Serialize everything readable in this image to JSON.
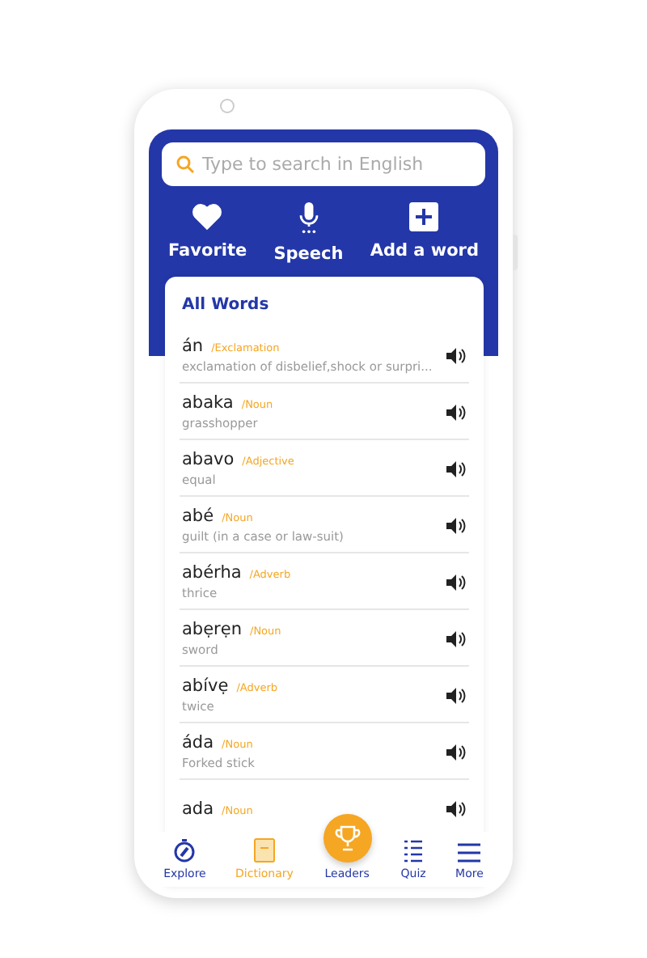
{
  "search": {
    "placeholder": "Type to search in English"
  },
  "actions": [
    {
      "kind": "heart",
      "label": "Favorite"
    },
    {
      "kind": "mic",
      "label": "Speech"
    },
    {
      "kind": "plus",
      "label": "Add a word"
    }
  ],
  "list": {
    "title": "All Words",
    "words": [
      {
        "word": "án",
        "part": "/Exclamation",
        "meaning": "exclamation of disbelief,shock or surpri..."
      },
      {
        "word": "abaka",
        "part": "/Noun",
        "meaning": "grasshopper"
      },
      {
        "word": "abavo",
        "part": "/Adjective",
        "meaning": "equal"
      },
      {
        "word": "abé",
        "part": "/Noun",
        "meaning": "guilt (in a case or law-suit)"
      },
      {
        "word": "abérha",
        "part": "/Adverb",
        "meaning": "thrice"
      },
      {
        "word": "abẹrẹn",
        "part": "/Noun",
        "meaning": "sword"
      },
      {
        "word": "abívẹ",
        "part": "/Adverb",
        "meaning": "twice"
      },
      {
        "word": "áda",
        "part": "/Noun",
        "meaning": "Forked stick"
      },
      {
        "word": "ada",
        "part": "/Noun"
      }
    ]
  },
  "nav": [
    {
      "kind": "compass",
      "label": "Explore",
      "selected": false
    },
    {
      "kind": "book",
      "label": "Dictionary",
      "selected": true
    },
    {
      "kind": "trophy",
      "label": "Leaders",
      "selected": false
    },
    {
      "kind": "quiz",
      "label": "Quiz",
      "selected": false
    },
    {
      "kind": "menu",
      "label": "More",
      "selected": false
    }
  ]
}
